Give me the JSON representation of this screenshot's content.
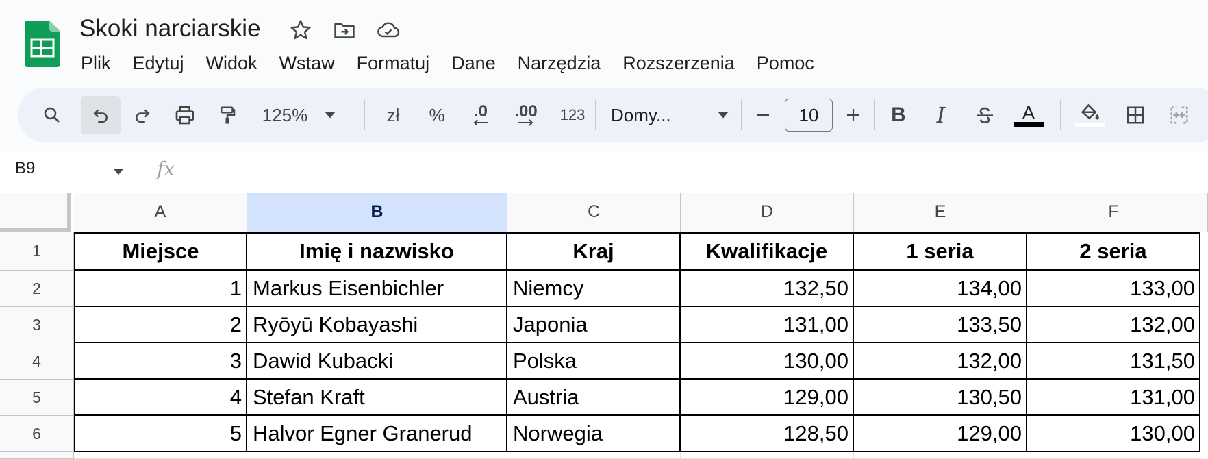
{
  "app": {
    "title": "Skoki narciarskie",
    "accent_color": "#188038"
  },
  "menu": [
    "Plik",
    "Edytuj",
    "Widok",
    "Wstaw",
    "Formatuj",
    "Dane",
    "Narzędzia",
    "Rozszerzenia",
    "Pomoc"
  ],
  "toolbar": {
    "zoom": "125%",
    "currency": "zł",
    "percent": "%",
    "decrease_decimals": ".0",
    "increase_decimals": ".00",
    "number_format": "123",
    "font": "Domy...",
    "font_size": "10",
    "bold": "B",
    "italic": "I",
    "text_color": "A"
  },
  "formula_bar": {
    "cell_ref": "B9",
    "fx": "fx",
    "value": ""
  },
  "sheet": {
    "columns": [
      "A",
      "B",
      "C",
      "D",
      "E",
      "F"
    ],
    "selected_column": "B",
    "row_numbers": [
      "1",
      "2",
      "3",
      "4",
      "5",
      "6"
    ],
    "rows": [
      [
        "Miejsce",
        "Imię i nazwisko",
        "Kraj",
        "Kwalifikacje",
        "1 seria",
        "2 seria"
      ],
      [
        "1",
        "Markus Eisenbichler",
        "Niemcy",
        "132,50",
        "134,00",
        "133,00"
      ],
      [
        "2",
        "Ryōyū Kobayashi",
        "Japonia",
        "131,00",
        "133,50",
        "132,00"
      ],
      [
        "3",
        "Dawid Kubacki",
        "Polska",
        "130,00",
        "132,00",
        "131,50"
      ],
      [
        "4",
        "Stefan Kraft",
        "Austria",
        "129,00",
        "130,50",
        "131,00"
      ],
      [
        "5",
        "Halvor Egner Granerud",
        "Norwegia",
        "128,50",
        "129,00",
        "130,00"
      ]
    ]
  }
}
